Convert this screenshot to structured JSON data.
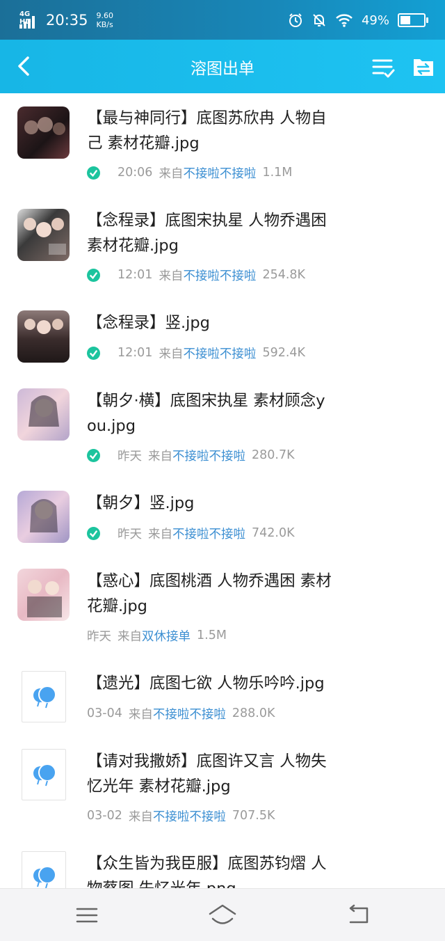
{
  "status_bar": {
    "network": "4G HD",
    "time": "20:35",
    "speed_value": "9.60",
    "speed_unit": "KB/s",
    "battery_percent": "49%",
    "battery_level": 0.49,
    "icons": [
      "alarm-icon",
      "mute-bell-icon",
      "wifi-icon",
      "battery-icon"
    ]
  },
  "header": {
    "title": "溶图出单",
    "back_icon": "chevron-left-icon",
    "select_icon": "list-check-icon",
    "folder_icon": "folder-transfer-icon"
  },
  "colors": {
    "header_bg": "#1ec3f2",
    "status_bg": "#1887b8",
    "source_link": "#3c8fd2",
    "check": "#1cc49e",
    "meta_gray": "#9a9a9a"
  },
  "files": [
    {
      "name_line1": "【最与神同行】底图苏欣冉 人物自",
      "name_line2": "己 素材花瓣.jpg",
      "time": "20:06",
      "from": "来自",
      "source": "不接啦不接啦",
      "size": "1.1M",
      "checked": true,
      "thumb": "image"
    },
    {
      "name_line1": "【念程录】底图宋执星 人物乔遇困",
      "name_line2": "素材花瓣.jpg",
      "time": "12:01",
      "from": "来自",
      "source": "不接啦不接啦",
      "size": "254.8K",
      "checked": true,
      "thumb": "image"
    },
    {
      "name_line1": "【念程录】竖.jpg",
      "name_line2": "",
      "time": "12:01",
      "from": "来自",
      "source": "不接啦不接啦",
      "size": "592.4K",
      "checked": true,
      "thumb": "image"
    },
    {
      "name_line1": "【朝夕·横】底图宋执星 素材顾念y",
      "name_line2": "ou.jpg",
      "time": "昨天",
      "from": "来自",
      "source": "不接啦不接啦",
      "size": "280.7K",
      "checked": true,
      "thumb": "image"
    },
    {
      "name_line1": "【朝夕】竖.jpg",
      "name_line2": "",
      "time": "昨天",
      "from": "来自",
      "source": "不接啦不接啦",
      "size": "742.0K",
      "checked": true,
      "thumb": "image"
    },
    {
      "name_line1": "【惑心】底图桃酒 人物乔遇困 素材",
      "name_line2": "花瓣.jpg",
      "time": "昨天",
      "from": "来自",
      "source": "双休接单",
      "size": "1.5M",
      "checked": false,
      "thumb": "image"
    },
    {
      "name_line1": "【遗光】底图七欲 人物乐吟吟.jpg",
      "name_line2": "",
      "time": "03-04",
      "from": "来自",
      "source": "不接啦不接啦",
      "size": "288.0K",
      "checked": false,
      "thumb": "qq-file"
    },
    {
      "name_line1": "【请对我撒娇】底图许又言 人物失",
      "name_line2": "忆光年 素材花瓣.jpg",
      "time": "03-02",
      "from": "来自",
      "source": "不接啦不接啦",
      "size": "707.5K",
      "checked": false,
      "thumb": "qq-file"
    },
    {
      "name_line1": "【众生皆为我臣服】底图苏钧熠 人",
      "name_line2": "物蔡图 失忆光年 png",
      "time": "",
      "from": "",
      "source": "",
      "size": "",
      "checked": false,
      "thumb": "qq-file"
    }
  ],
  "nav_bar": {
    "icons": [
      "menu-icon",
      "home-icon",
      "back-icon"
    ]
  }
}
